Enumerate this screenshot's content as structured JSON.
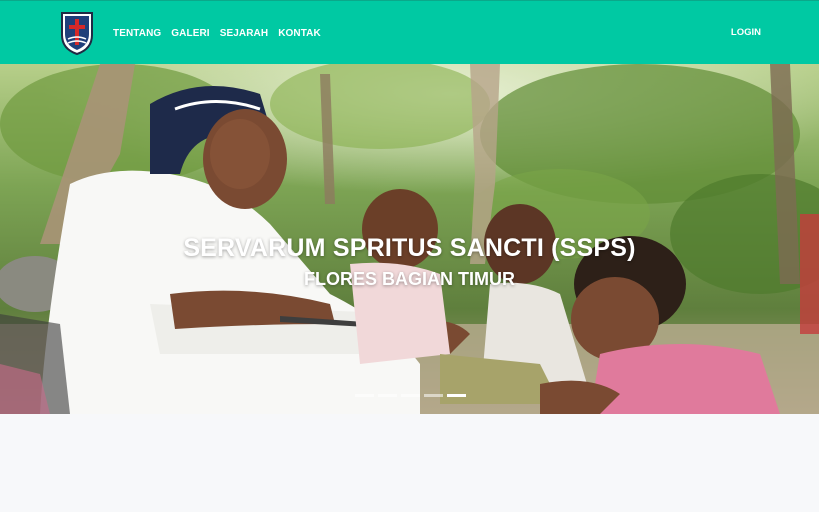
{
  "navbar": {
    "bg_color": "#00c9a3",
    "logo_icon": "shield-cross-icon",
    "links": [
      {
        "label": "TENTANG"
      },
      {
        "label": "GALERI"
      },
      {
        "label": "SEJARAH"
      },
      {
        "label": "KONTAK"
      }
    ],
    "login_label": "LOGIN"
  },
  "hero": {
    "title": "SERVARUM SPRITUS SANCTI (SSPS)",
    "subtitle": "FLORES BAGIAN TIMUR",
    "slide_count": 5,
    "active_slide": 5
  }
}
